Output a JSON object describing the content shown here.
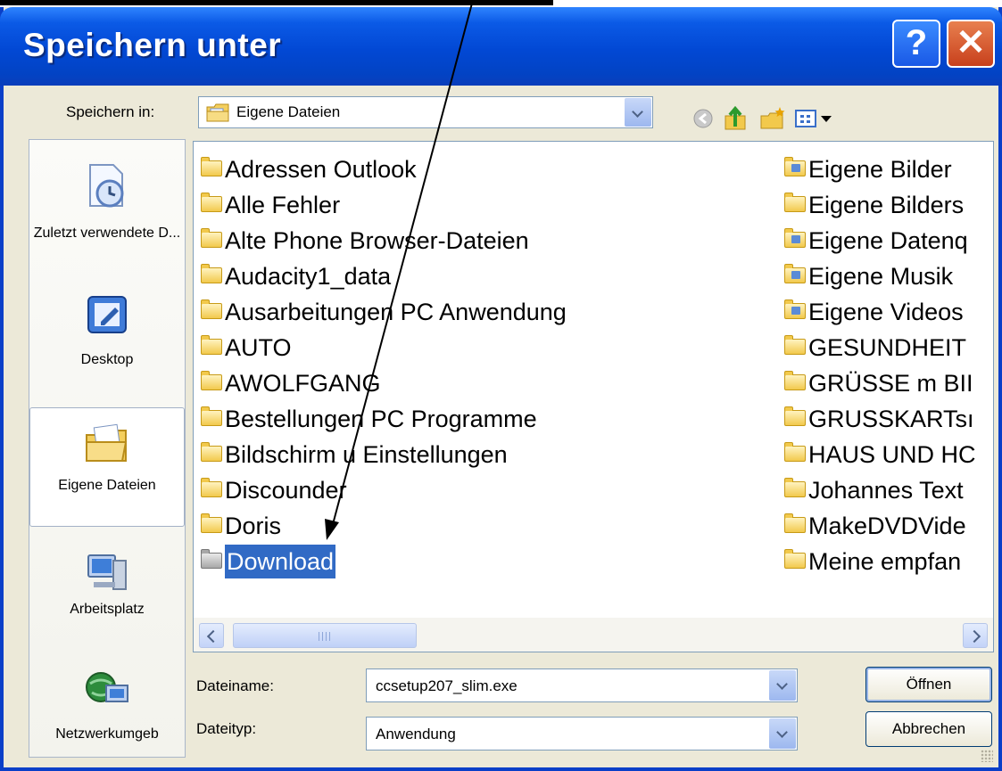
{
  "dialog": {
    "title": "Speichern unter",
    "help_glyph": "?",
    "close_glyph": "✕"
  },
  "save_in": {
    "label": "Speichern in:",
    "value": "Eigene Dateien"
  },
  "toolbar": {
    "icons": [
      "back-icon",
      "up-folder-icon",
      "new-folder-icon",
      "view-menu-icon"
    ]
  },
  "places": [
    {
      "label": "Zuletzt verwendete D...",
      "icon": "recent-documents-icon"
    },
    {
      "label": "Desktop",
      "icon": "desktop-icon"
    },
    {
      "label": "Eigene Dateien",
      "icon": "my-documents-icon",
      "selected": true
    },
    {
      "label": "Arbeitsplatz",
      "icon": "my-computer-icon"
    },
    {
      "label": "Netzwerkumgeb",
      "icon": "network-icon"
    }
  ],
  "files_col1": [
    "Adressen Outlook",
    "Alle Fehler",
    "Alte Phone Browser-Dateien",
    "Audacity1_data",
    "Ausarbeitungen PC Anwendung",
    "AUTO",
    "AWOLFGANG",
    "Bestellungen PC Programme",
    "Bildschirm u Einstellungen",
    "Discounder",
    "Doris",
    "Download"
  ],
  "files_col2": [
    "Eigene Bilder",
    "Eigene Bilders",
    "Eigene Datenq",
    "Eigene Musik",
    "Eigene Videos",
    "GESUNDHEIT",
    "GRÜSSE m BII",
    "GRUSSKARTsı",
    "HAUS UND HC",
    "Johannes Text",
    "MakeDVDVide",
    "Meine empfan"
  ],
  "selected_file": "Download",
  "filename": {
    "label": "Dateiname:",
    "value": "ccsetup207_slim.exe"
  },
  "filetype": {
    "label": "Dateityp:",
    "value": "Anwendung"
  },
  "buttons": {
    "open": "Öffnen",
    "cancel": "Abbrechen"
  },
  "colors": {
    "titlebar": "#0248d4",
    "selection": "#316ac5",
    "dialog_bg": "#ece9d8"
  }
}
